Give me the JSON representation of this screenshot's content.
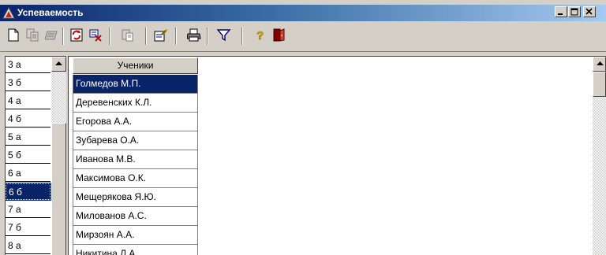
{
  "window": {
    "title": "Успеваемость"
  },
  "toolbar": {
    "buttons": [
      {
        "icon": "new-document-icon"
      },
      {
        "icon": "copy-pages-icon"
      },
      {
        "icon": "edit-record-icon"
      },
      {
        "icon": "refresh-icon"
      },
      {
        "icon": "delete-record-icon"
      },
      {
        "icon": "paste-icon"
      },
      {
        "icon": "edit-form-icon"
      },
      {
        "icon": "printer-icon"
      },
      {
        "icon": "filter-icon"
      },
      {
        "icon": "help-icon"
      },
      {
        "icon": "exit-door-icon"
      }
    ]
  },
  "classes": {
    "items": [
      "3 а",
      "3 б",
      "4 а",
      "4 б",
      "5 а",
      "5 б",
      "6 а",
      "6 б",
      "7 а",
      "7 б",
      "8 а"
    ],
    "selected": "6 б"
  },
  "students": {
    "header": "Ученики",
    "rows": [
      "Голмедов М.П.",
      "Деревенских К.Л.",
      "Егорова А.А.",
      "Зубарева О.А.",
      "Иванова М.В.",
      "Максимова О.К.",
      "Мещерякова Я.Ю.",
      "Милованов А.С.",
      "Мирзоян А.А.",
      "Никитина Л.А."
    ],
    "selected": "Голмедов М.П."
  },
  "colors": {
    "titlebar_start": "#0a246a",
    "titlebar_end": "#a6caf0",
    "selection": "#0a246a",
    "face": "#d4d0c8"
  }
}
